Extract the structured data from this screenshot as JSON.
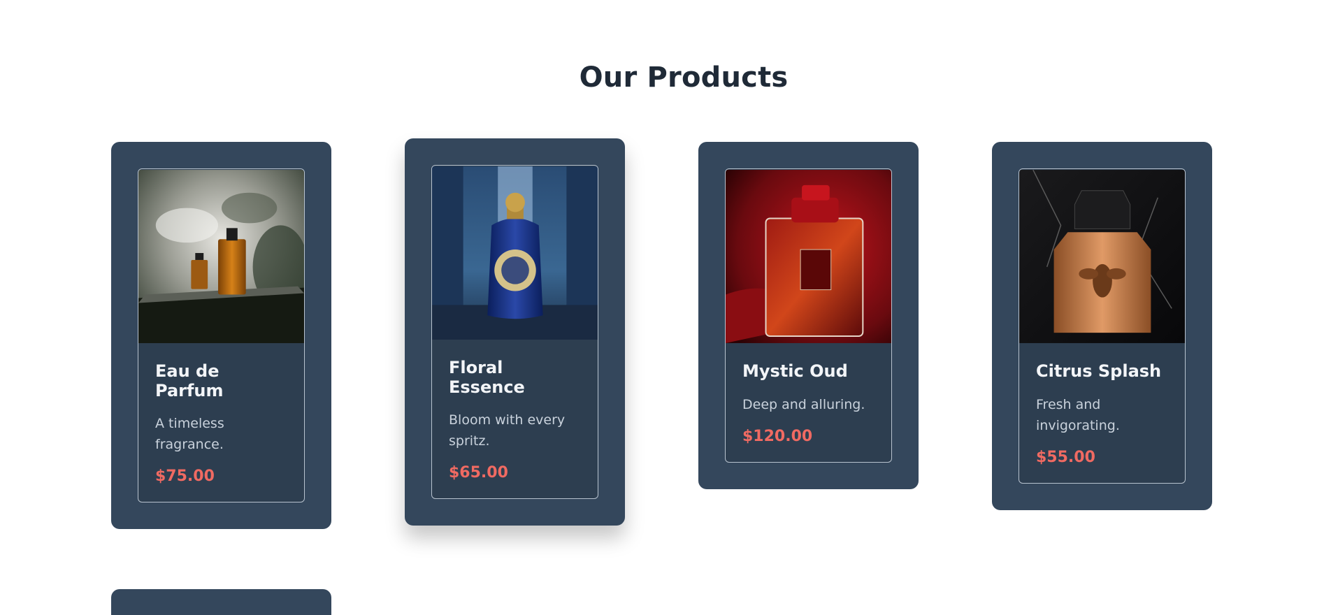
{
  "page": {
    "title": "Our Products"
  },
  "products": [
    {
      "name": "Eau de Parfum",
      "description": "A timeless fragrance.",
      "price": "$75.00"
    },
    {
      "name": "Floral Essence",
      "description": "Bloom with every spritz.",
      "price": "$65.00"
    },
    {
      "name": "Mystic Oud",
      "description": "Deep and alluring.",
      "price": "$120.00"
    },
    {
      "name": "Citrus Splash",
      "description": "Fresh and invigorating.",
      "price": "$55.00"
    }
  ],
  "colors": {
    "card_background": "#34475c",
    "inner_background": "#2d3e50",
    "price": "#f06a62",
    "title": "#1f2a37"
  }
}
